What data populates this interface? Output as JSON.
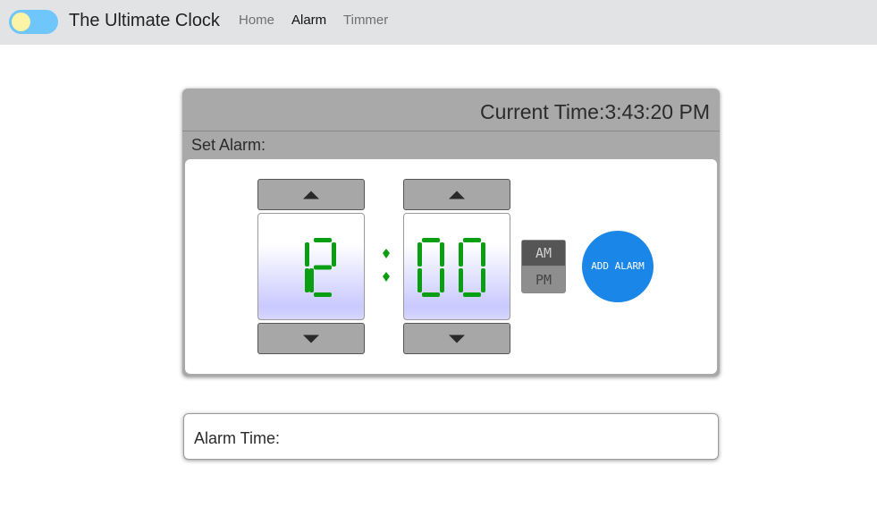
{
  "navbar": {
    "brand": "The Ultimate Clock",
    "links": [
      {
        "label": "Home",
        "active": false
      },
      {
        "label": "Alarm",
        "active": true
      },
      {
        "label": "Timmer",
        "active": false
      }
    ],
    "toggle": {
      "state": "off"
    }
  },
  "clock": {
    "current_time_label": "Current Time:3:43:20 PM"
  },
  "alarm_setter": {
    "title": "Set Alarm:",
    "hours": "12",
    "minutes": "00",
    "am_label": "AM",
    "pm_label": "PM",
    "selected_period": "AM",
    "add_button_label": "ADD ALARM",
    "digit_color": "#0a9e12"
  },
  "alarm_list": {
    "label": "Alarm Time:"
  },
  "colors": {
    "navbar_bg": "#e2e3e5",
    "card_bg": "#a9a9a9",
    "add_button": "#1a86e8",
    "toggle_track": "#6ec6fb",
    "toggle_knob": "#fbf3a6"
  }
}
